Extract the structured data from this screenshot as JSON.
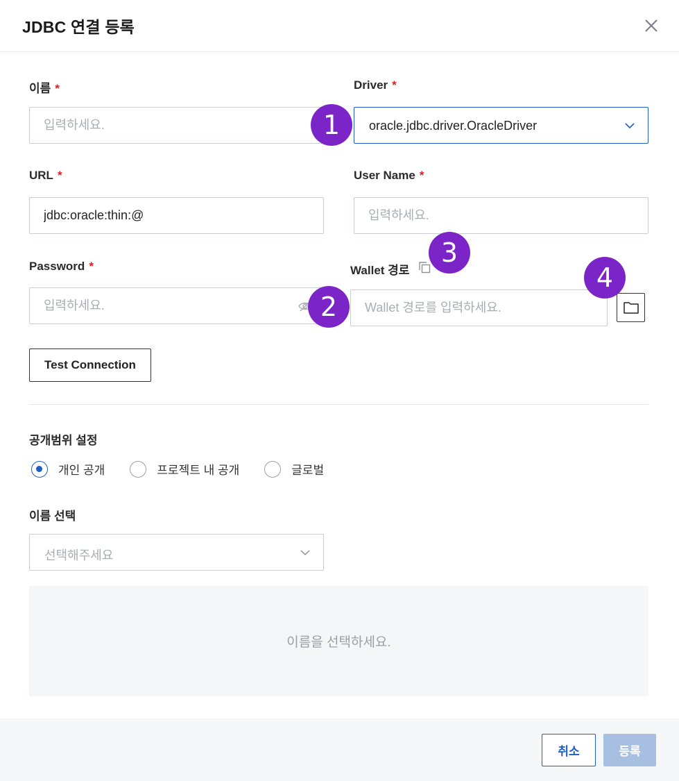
{
  "dialog": {
    "title": "JDBC 연결 등록"
  },
  "fields": {
    "name": {
      "label": "이름",
      "placeholder": "입력하세요."
    },
    "driver": {
      "label": "Driver",
      "value": "oracle.jdbc.driver.OracleDriver"
    },
    "url": {
      "label": "URL",
      "value": "jdbc:oracle:thin:@"
    },
    "username": {
      "label": "User Name",
      "placeholder": "입력하세요."
    },
    "password": {
      "label": "Password",
      "placeholder": "입력하세요."
    },
    "wallet": {
      "label": "Wallet 경로",
      "placeholder": "Wallet 경로를 입력하세요."
    },
    "required_mark": "*"
  },
  "test_connection": {
    "label": "Test Connection"
  },
  "visibility": {
    "label": "공개범위 설정",
    "options": [
      "개인 공개",
      "프로젝트 내 공개",
      "글로벌"
    ],
    "selected": "개인 공개"
  },
  "name_select": {
    "label": "이름 선택",
    "placeholder": "선택해주세요",
    "empty_message": "이름을 선택하세요."
  },
  "footer": {
    "cancel_label": "취소",
    "submit_label": "등록"
  },
  "annotations": [
    "1",
    "2",
    "3",
    "4"
  ],
  "colors": {
    "accent": "#1f5fc4",
    "badge": "#7b24c7",
    "required": "#e02020",
    "submit_disabled": "#a7bfe0"
  }
}
